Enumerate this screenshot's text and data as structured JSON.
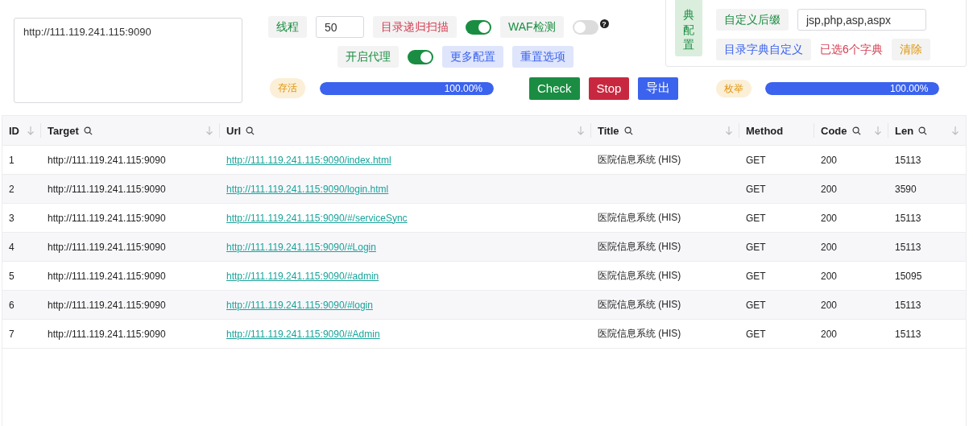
{
  "targets": {
    "value": "http://111.119.241.115:9090"
  },
  "options": {
    "threads_label": "线程",
    "threads_value": "50",
    "recursive": {
      "label": "目录递归扫描",
      "on": true
    },
    "waf": {
      "label": "WAF检测",
      "on": false,
      "help": "?"
    },
    "proxy": {
      "label": "开启代理",
      "on": true
    },
    "buttons": [
      "更多配置",
      "重置选项"
    ]
  },
  "dict_panel": {
    "title": "典配置",
    "suffix_label": "自定义后缀",
    "suffix_value": "jsp,php,asp,aspx",
    "custom_label": "目录字典自定义",
    "selected_text": "已选6个字典",
    "clear": "清除"
  },
  "progress": [
    {
      "badge": "存活",
      "level": 1.0,
      "reading": "100.00%"
    },
    {
      "badge": "枚举",
      "level": 1.0,
      "reading": "100.00%"
    }
  ],
  "actions": [
    {
      "label": "Check",
      "kind": "check"
    },
    {
      "label": "Stop",
      "kind": "stop"
    },
    {
      "label": "导出",
      "kind": "export"
    }
  ],
  "table": {
    "columns": [
      {
        "label": "ID",
        "searchable": false,
        "sortable": true
      },
      {
        "label": "Target",
        "searchable": true,
        "sortable": true
      },
      {
        "label": "Url",
        "searchable": true,
        "sortable": true
      },
      {
        "label": "Title",
        "searchable": true,
        "sortable": true
      },
      {
        "label": "Method",
        "searchable": false,
        "sortable": false
      },
      {
        "label": "Code",
        "searchable": true,
        "sortable": true
      },
      {
        "label": "Len",
        "searchable": true,
        "sortable": true
      }
    ],
    "rows": [
      [
        "1",
        "http://111.119.241.115:9090",
        "http://111.119.241.115:9090/index.html",
        "医院信息系统 (HIS)",
        "GET",
        "200",
        "15113"
      ],
      [
        "2",
        "http://111.119.241.115:9090",
        "http://111.119.241.115:9090/login.html",
        "",
        "GET",
        "200",
        "3590"
      ],
      [
        "3",
        "http://111.119.241.115:9090",
        "http://111.119.241.115:9090/#/serviceSync",
        "医院信息系统 (HIS)",
        "GET",
        "200",
        "15113"
      ],
      [
        "4",
        "http://111.119.241.115:9090",
        "http://111.119.241.115:9090/#Login",
        "医院信息系统 (HIS)",
        "GET",
        "200",
        "15113"
      ],
      [
        "5",
        "http://111.119.241.115:9090",
        "http://111.119.241.115:9090/#admin",
        "医院信息系统 (HIS)",
        "GET",
        "200",
        "15095"
      ],
      [
        "6",
        "http://111.119.241.115:9090",
        "http://111.119.241.115:9090/#login",
        "医院信息系统 (HIS)",
        "GET",
        "200",
        "15113"
      ],
      [
        "7",
        "http://111.119.241.115:9090",
        "http://111.119.241.115:9090/#Admin",
        "医院信息系统 (HIS)",
        "GET",
        "200",
        "15113"
      ]
    ]
  }
}
